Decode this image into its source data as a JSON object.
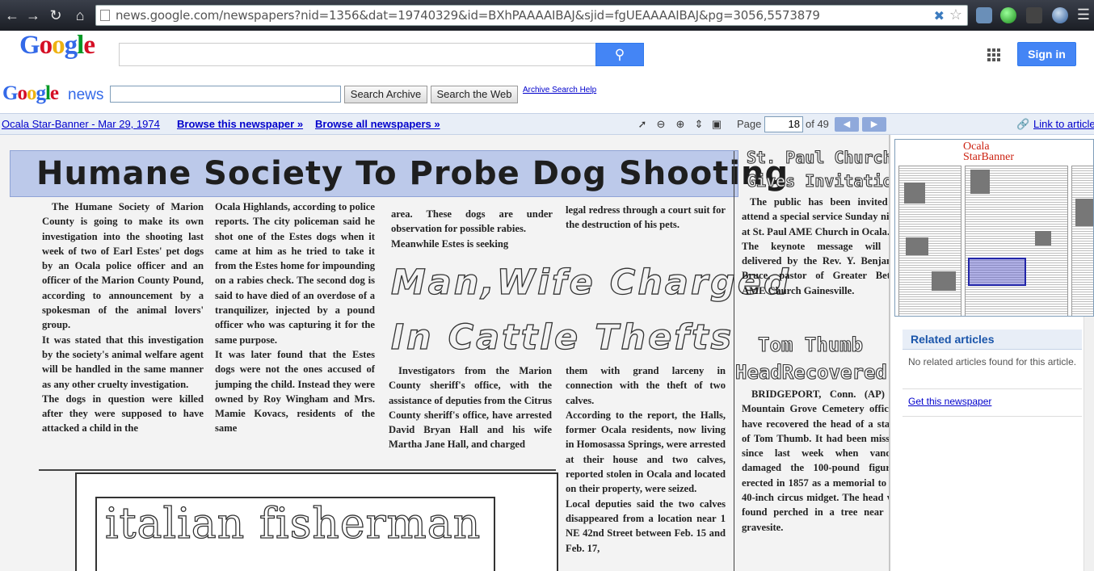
{
  "browser": {
    "url": "news.google.com/newspapers?nid=1356&dat=19740329&id=BXhPAAAAIBAJ&sjid=fgUEAAAAIBAJ&pg=3056,5573879",
    "back_icon": "back-arrow-icon",
    "forward_icon": "forward-arrow-icon",
    "reload_icon": "reload-icon",
    "home_icon": "home-icon"
  },
  "google_header": {
    "logo": [
      "G",
      "o",
      "o",
      "g",
      "l",
      "e"
    ],
    "search_placeholder": "",
    "search_icon": "search-icon",
    "signin_label": "Sign in",
    "brand_blue": "#4485f5"
  },
  "news_bar": {
    "news_word": "news",
    "archive_input_value": "",
    "search_archive_label": "Search Archive",
    "search_web_label": "Search the Web",
    "archive_help_label": "Archive Search Help"
  },
  "toolbar": {
    "paper_link": "Ocala Star-Banner - Mar 29, 1974",
    "browse_this": "Browse this newspaper »",
    "browse_all": "Browse all newspapers »",
    "page_label": "Page",
    "page_value": "18",
    "page_of": "of 49",
    "link_to_article": "Link to article",
    "prev_icon": "previous-page-icon",
    "next_icon": "next-page-icon"
  },
  "paper": {
    "headline": "Humane Society To Probe Dog Shooting",
    "col1": "The Humane Society of Marion County is going to make its own investigation into the shooting last week of two of Earl Estes' pet dogs by an Ocala police officer and an officer of the Marion County Pound, according to announcement by a spokesman of the animal lovers' group.\nIt was stated that this investigation by the society's animal welfare agent will be handled in the same manner as any other cruelty investigation.\nThe dogs in question were killed after they were supposed to have attacked a child in the",
    "col2": "Ocala Highlands, according to police reports. The city policeman said he shot one of the Estes dogs when it came at him as he tried to take it from the Estes home for impounding on a rabies check. The second dog is said to have died of an overdose of a tranquilizer, injected by a pound officer who was capturing it for the same purpose.\nIt was later found that the Estes dogs were not the ones accused of jumping the child. Instead they were owned by Roy Wingham and Mrs. Mamie Kovacs, residents of the same",
    "col3": "area. These dogs are under observation for possible rabies.\nMeanwhile Estes is seeking",
    "col4": "legal redress through a court suit for the destruction of his pets.",
    "headline2_line1": "Man,Wife Charged",
    "headline2_line2": "In Cattle Thefts",
    "col5": "Investigators from the Marion County sheriff's office, with the assistance of deputies from the Citrus County sheriff's office, have arrested David Bryan Hall and his wife Martha Jane Hall, and charged",
    "col6": "them with grand larceny in connection with the theft of two calves.\nAccording to the report, the Halls, former Ocala residents, now living in Homosassa Springs, were arrested at their house and two calves, reported stolen in Ocala and located on their property, were seized.\nLocal deputies said the two calves disappeared from a location near 1 NE 42nd Street between Feb. 15 and Feb. 17,",
    "side_head1_line1": "St. Paul Church",
    "side_head1_line2": "Gives Invitation",
    "side_col1": "The public has been invited to attend a special service Sunday night at St. Paul AME Church in Ocala.\nThe keynote message will be delivered by the Rev. Y. Benjamin Bruce, pastor of Greater Bethel AME Church Gainesville.",
    "side_head2_line1": "Tom Thumb",
    "side_head2_line2": "HeadRecovered",
    "side_col2": "BRIDGEPORT, Conn. (AP) — Mountain Grove Cemetery officials have recovered the head of a statue of Tom Thumb. It had been missing since last week when vandals damaged the 100-pound figurine erected in 1857 as a memorial to the 40-inch circus midget. The head was found perched in a tree near the gravesite.",
    "ad_text": "italian fisherman"
  },
  "side_panel": {
    "thumb_title_line1": "Ocala",
    "thumb_title_line2": "StarBanner",
    "related_title": "Related articles",
    "no_related": "No related articles found for this article.",
    "get_newspaper": "Get this newspaper"
  }
}
